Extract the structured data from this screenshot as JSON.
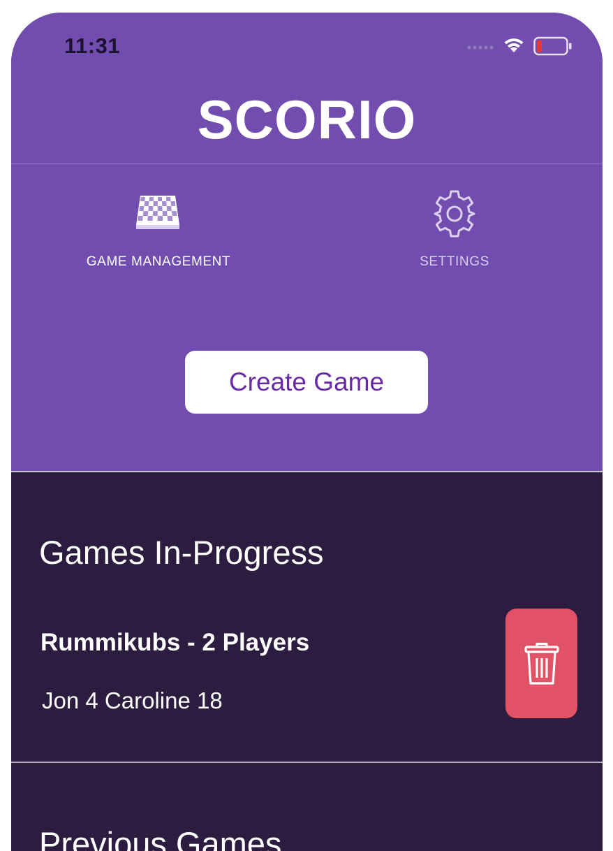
{
  "status_bar": {
    "time": "11:31",
    "icons": [
      "signal-dots-icon",
      "wifi-icon",
      "battery-low-icon"
    ]
  },
  "header": {
    "title": "SCORIO"
  },
  "nav": {
    "items": [
      {
        "label": "GAME MANAGEMENT",
        "icon": "checkerboard-icon",
        "active": true
      },
      {
        "label": "SETTINGS",
        "icon": "gear-icon",
        "active": false
      }
    ]
  },
  "actions": {
    "create_game_label": "Create Game"
  },
  "sections": {
    "in_progress": {
      "heading": "Games In-Progress",
      "games": [
        {
          "title": "Rummikubs - 2 Players",
          "scores": "Jon 4 Caroline 18",
          "delete_icon": "trash-icon"
        }
      ]
    },
    "previous": {
      "heading": "Previous Games"
    }
  },
  "colors": {
    "header_purple": "#704daf",
    "dark_background": "#2c1d40",
    "button_text": "#6a2aa8",
    "delete_red": "#e25266",
    "battery_red": "#e53935"
  }
}
